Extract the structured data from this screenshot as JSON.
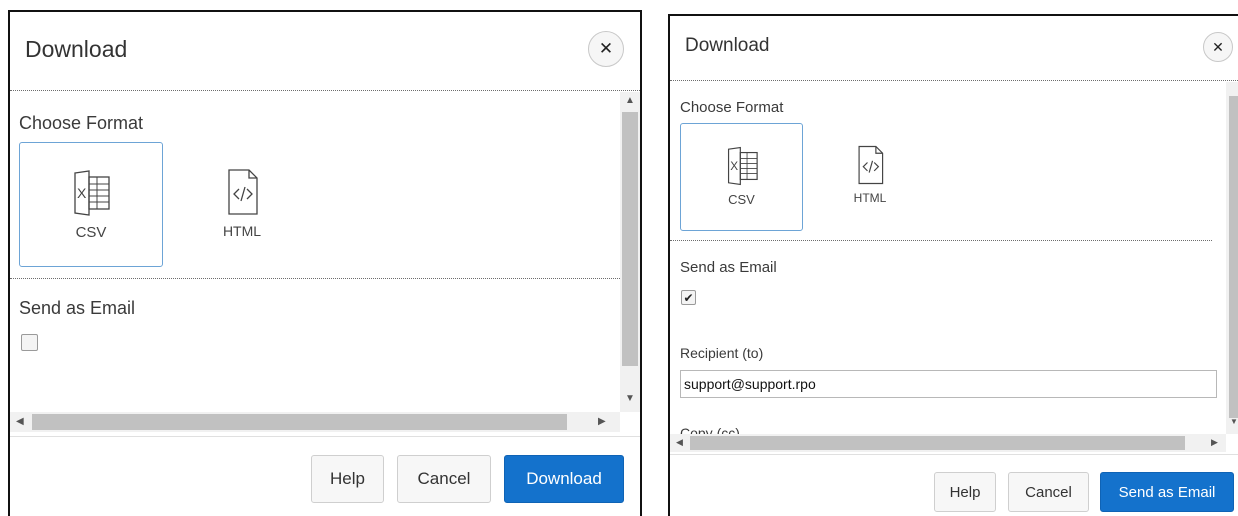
{
  "left": {
    "title": "Download",
    "close_glyph": "✕",
    "section_format": "Choose Format",
    "formats": [
      {
        "label": "CSV",
        "icon": "csv-file-icon",
        "selected": true
      },
      {
        "label": "HTML",
        "icon": "html-file-icon",
        "selected": false
      }
    ],
    "section_email": "Send as Email",
    "email_checked": false,
    "buttons": {
      "help": "Help",
      "cancel": "Cancel",
      "primary": "Download"
    }
  },
  "right": {
    "title": "Download",
    "close_glyph": "✕",
    "section_format": "Choose Format",
    "formats": [
      {
        "label": "CSV",
        "icon": "csv-file-icon",
        "selected": true
      },
      {
        "label": "HTML",
        "icon": "html-file-icon",
        "selected": false
      }
    ],
    "section_email": "Send as Email",
    "email_checked": true,
    "check_glyph": "✔",
    "recipient_label": "Recipient (to)",
    "recipient_value": "support@support.rpo",
    "copy_label_partial": "Copy (cc)",
    "buttons": {
      "help": "Help",
      "cancel": "Cancel",
      "primary": "Send as Email"
    }
  },
  "colors": {
    "primary_button": "#1472cc",
    "selected_border": "#6da4d6"
  }
}
